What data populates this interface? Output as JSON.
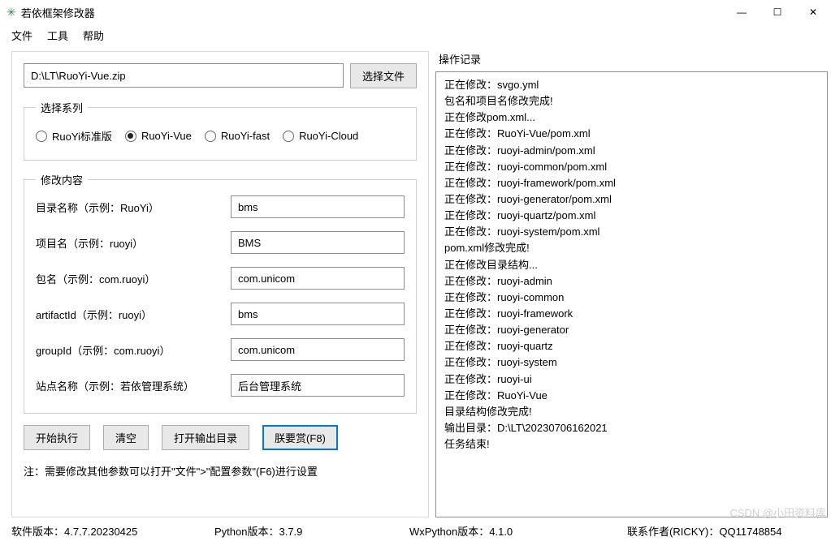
{
  "window": {
    "title": "若依框架修改器"
  },
  "menu": {
    "file": "文件",
    "tools": "工具",
    "help": "帮助"
  },
  "filePath": {
    "value": "D:\\LT\\RuoYi-Vue.zip",
    "chooseBtn": "选择文件"
  },
  "series": {
    "legend": "选择系列",
    "options": [
      {
        "label": "RuoYi标准版",
        "checked": false
      },
      {
        "label": "RuoYi-Vue",
        "checked": true
      },
      {
        "label": "RuoYi-fast",
        "checked": false
      },
      {
        "label": "RuoYi-Cloud",
        "checked": false
      }
    ]
  },
  "modify": {
    "legend": "修改内容",
    "fields": {
      "dirName": {
        "label": "目录名称（示例：RuoYi）",
        "value": "bms"
      },
      "projName": {
        "label": "项目名（示例：ruoyi）",
        "value": "BMS"
      },
      "pkgName": {
        "label": "包名（示例：com.ruoyi）",
        "value": "com.unicom"
      },
      "artifactId": {
        "label": "artifactId（示例：ruoyi）",
        "value": "bms"
      },
      "groupId": {
        "label": "groupId（示例：com.ruoyi）",
        "value": "com.unicom"
      },
      "siteName": {
        "label": "站点名称（示例：若依管理系统）",
        "value": "后台管理系统"
      }
    }
  },
  "actions": {
    "start": "开始执行",
    "clear": "清空",
    "openOut": "打开输出目录",
    "donate": "朕要赏(F8)"
  },
  "note": "注：需要修改其他参数可以打开\"文件\">\"配置参数\"(F6)进行设置",
  "log": {
    "title": "操作记录",
    "lines": [
      "正在修改：svgo.yml",
      "包名和项目名修改完成!",
      "正在修改pom.xml...",
      "正在修改：RuoYi-Vue/pom.xml",
      "正在修改：ruoyi-admin/pom.xml",
      "正在修改：ruoyi-common/pom.xml",
      "正在修改：ruoyi-framework/pom.xml",
      "正在修改：ruoyi-generator/pom.xml",
      "正在修改：ruoyi-quartz/pom.xml",
      "正在修改：ruoyi-system/pom.xml",
      "pom.xml修改完成!",
      "正在修改目录结构...",
      "正在修改：ruoyi-admin",
      "正在修改：ruoyi-common",
      "正在修改：ruoyi-framework",
      "正在修改：ruoyi-generator",
      "正在修改：ruoyi-quartz",
      "正在修改：ruoyi-system",
      "正在修改：ruoyi-ui",
      "正在修改：RuoYi-Vue",
      "目录结构修改完成!",
      "输出目录：D:\\LT\\20230706162021",
      "任务结束!"
    ]
  },
  "status": {
    "softVersion": "软件版本：4.7.7.20230425",
    "pyVersion": "Python版本：3.7.9",
    "wxVersion": "WxPython版本：4.1.0",
    "contact": "联系作者(RICKY)：QQ11748854"
  },
  "watermark": "CSDN @小田资料库"
}
